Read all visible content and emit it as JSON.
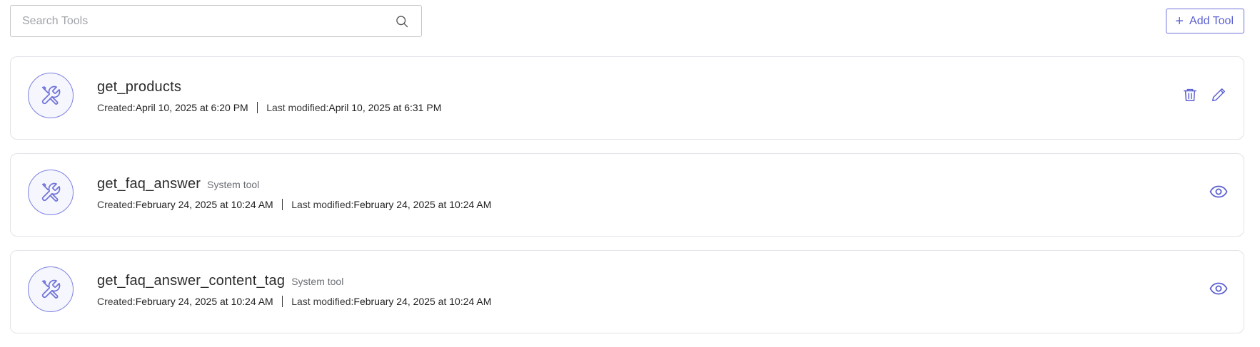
{
  "search": {
    "placeholder": "Search Tools",
    "value": ""
  },
  "toolbar": {
    "add_label": "Add Tool"
  },
  "labels": {
    "created": "Created:",
    "last_modified": "Last modified:"
  },
  "tools": [
    {
      "name": "get_products",
      "tag": "",
      "created": "April 10, 2025 at 6:20 PM",
      "modified": "April 10, 2025 at 6:31 PM",
      "actions": [
        "trash-icon",
        "edit-icon"
      ]
    },
    {
      "name": "get_faq_answer",
      "tag": "System tool",
      "created": "February 24, 2025 at 10:24 AM",
      "modified": "February 24, 2025 at 10:24 AM",
      "actions": [
        "eye-icon"
      ]
    },
    {
      "name": "get_faq_answer_content_tag",
      "tag": "System tool",
      "created": "February 24, 2025 at 10:24 AM",
      "modified": "February 24, 2025 at 10:24 AM",
      "actions": [
        "eye-icon"
      ]
    }
  ],
  "colors": {
    "accent": "#5a5fd0",
    "border": "#e2e3e8"
  }
}
